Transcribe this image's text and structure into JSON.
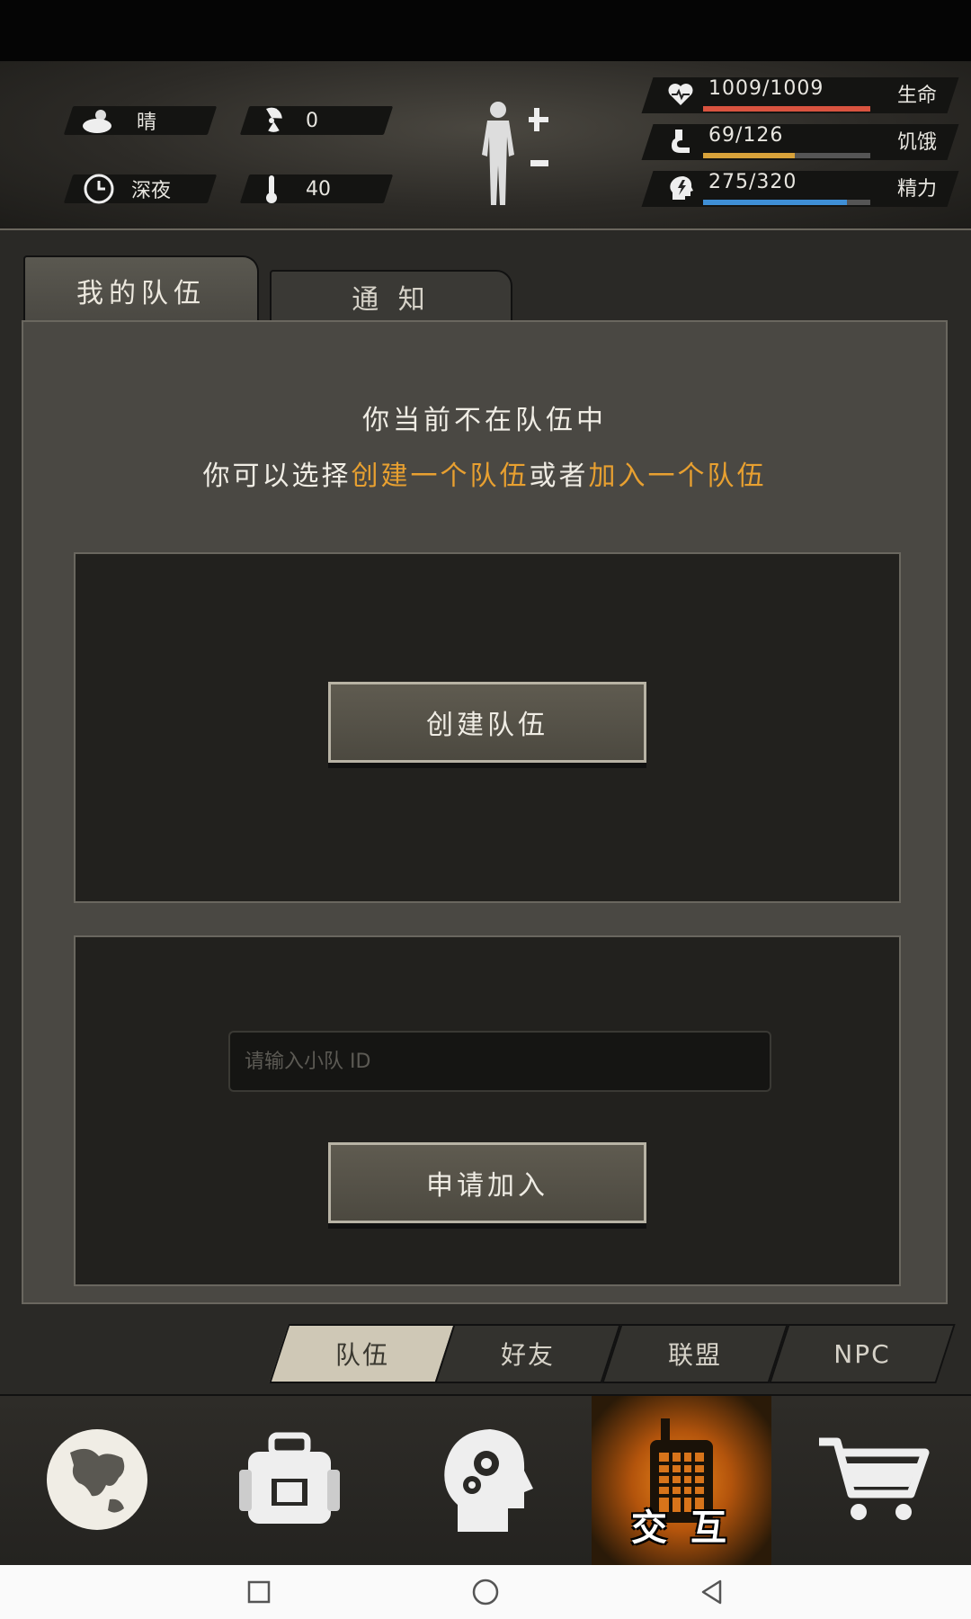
{
  "hud": {
    "weather": "晴",
    "radiation": "0",
    "time_of_day": "深夜",
    "temperature": "40",
    "stats": [
      {
        "value": "1009/1009",
        "label": "生命",
        "fill": 1.0,
        "color": "#d9533f"
      },
      {
        "value": "69/126",
        "label": "饥饿",
        "fill": 0.548,
        "color": "#d8a23a"
      },
      {
        "value": "275/320",
        "label": "精力",
        "fill": 0.859,
        "color": "#3f8fd6"
      }
    ]
  },
  "tabs": {
    "my_team": "我的队伍",
    "notice": "通 知"
  },
  "message": {
    "line1": "你当前不在队伍中",
    "line2_a": "你可以选择",
    "line2_b": "创建一个队伍",
    "line2_c": "或者",
    "line2_d": "加入一个队伍"
  },
  "create_button": "创建队伍",
  "join": {
    "placeholder": "请输入小队 ID",
    "button": "申请加入"
  },
  "subtabs": [
    {
      "label": "队伍",
      "active": true
    },
    {
      "label": "好友",
      "active": false
    },
    {
      "label": "联盟",
      "active": false
    },
    {
      "label": "NPC",
      "active": false
    }
  ],
  "nav": {
    "active_label": "交 互"
  },
  "colors": {
    "highlight": "#e8a030",
    "accent_orange": "#f08a1c"
  }
}
